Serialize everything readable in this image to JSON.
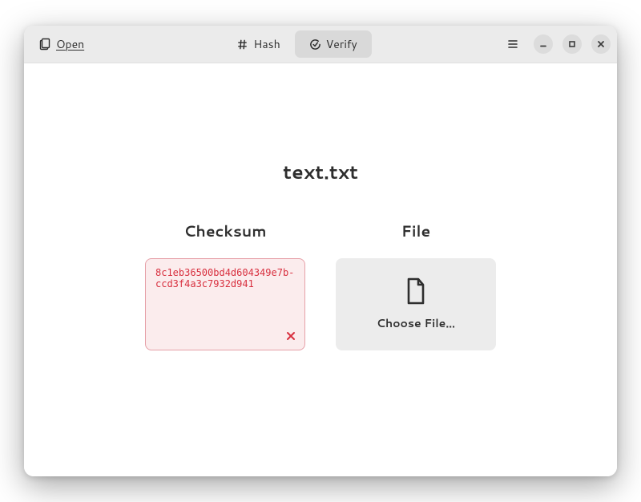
{
  "header": {
    "open_label": "Open",
    "tabs": {
      "hash": "Hash",
      "verify": "Verify"
    }
  },
  "main": {
    "filename": "text.txt",
    "checksum": {
      "label": "Checksum",
      "value": "8c1eb36500bd4d604349e7b-ccd3f4a3c7932d941"
    },
    "file": {
      "label": "File",
      "button_label": "Choose File…"
    }
  }
}
